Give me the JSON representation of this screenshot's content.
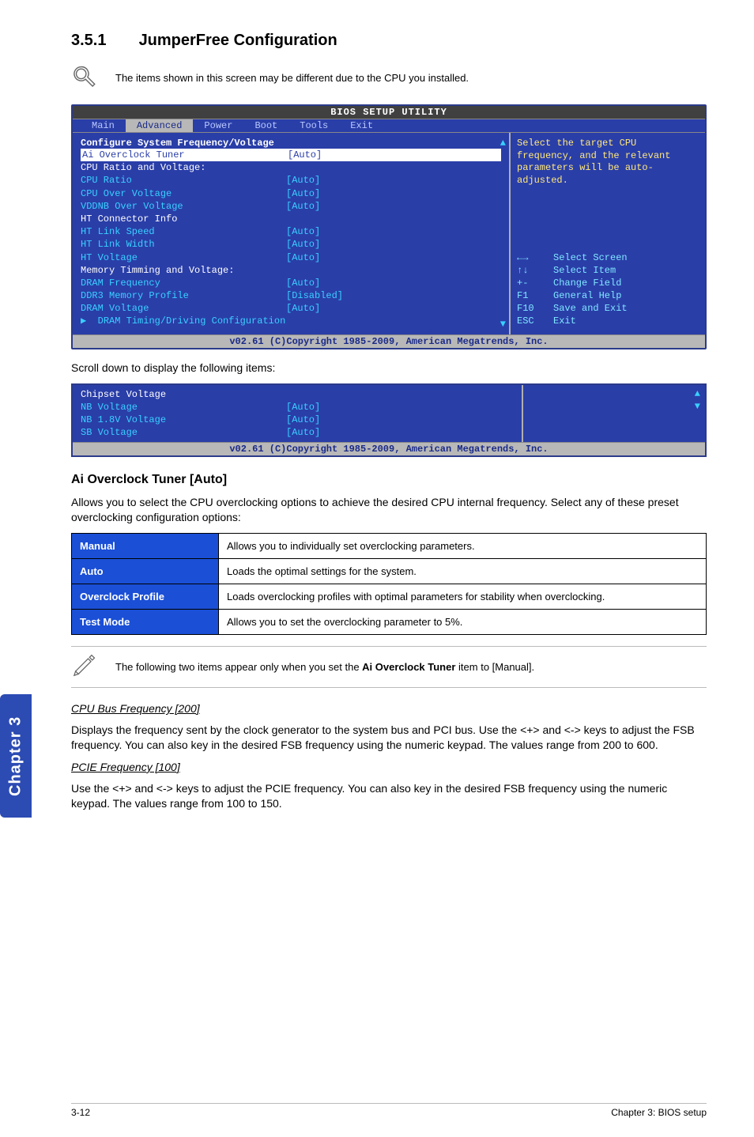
{
  "section": {
    "number": "3.5.1",
    "title": "JumperFree Configuration"
  },
  "note1": "The items shown in this screen may be different due to the CPU you installed.",
  "bios": {
    "title": "BIOS SETUP UTILITY",
    "tabs": [
      "Main",
      "Advanced",
      "Power",
      "Boot",
      "Tools",
      "Exit"
    ],
    "active_tab": 1,
    "main_heading": "Configure System Frequency/Voltage",
    "rows": [
      {
        "label": "Ai Overclock Tuner",
        "value": "[Auto]",
        "highlight": true
      },
      {
        "label": "",
        "value": ""
      },
      {
        "label": "CPU Ratio and Voltage:",
        "value": "",
        "white": true
      },
      {
        "label": "CPU Ratio",
        "value": "[Auto]",
        "bluelabel": true
      },
      {
        "label": "CPU Over Voltage",
        "value": "[Auto]",
        "bluelabel": true
      },
      {
        "label": "VDDNB Over Voltage",
        "value": "[Auto]",
        "bluelabel": true
      },
      {
        "label": "",
        "value": ""
      },
      {
        "label": "HT Connector Info",
        "value": "",
        "white": true
      },
      {
        "label": "HT Link Speed",
        "value": "[Auto]",
        "bluelabel": true
      },
      {
        "label": "HT Link Width",
        "value": "[Auto]",
        "bluelabel": true
      },
      {
        "label": "HT Voltage",
        "value": "[Auto]",
        "bluelabel": true
      },
      {
        "label": "",
        "value": ""
      },
      {
        "label": "Memory Timming and Voltage:",
        "value": "",
        "white": true
      },
      {
        "label": "DRAM Frequency",
        "value": "[Auto]",
        "bluelabel": true
      },
      {
        "label": "DDR3 Memory Profile",
        "value": "[Disabled]",
        "bluelabel": true
      },
      {
        "label": "DRAM Voltage",
        "value": "[Auto]",
        "bluelabel": true
      },
      {
        "label": "▶  DRAM Timing/Driving Configuration",
        "value": "",
        "bluelabel": true
      }
    ],
    "side_top": "Select the target CPU frequency, and the relevant parameters will be auto-adjusted.",
    "help": [
      {
        "key": "←→",
        "text": "Select Screen"
      },
      {
        "key": "↑↓",
        "text": "Select Item"
      },
      {
        "key": "+-",
        "text": "Change Field"
      },
      {
        "key": "F1",
        "text": "General Help"
      },
      {
        "key": "F10",
        "text": "Save and Exit"
      },
      {
        "key": "ESC",
        "text": "Exit"
      }
    ],
    "footer": "v02.61 (C)Copyright 1985-2009, American Megatrends, Inc."
  },
  "scroll_note": "Scroll down to display the following items:",
  "bios2": {
    "rows": [
      {
        "label": "Chipset Voltage",
        "value": "",
        "white": true
      },
      {
        "label": "NB Voltage",
        "value": "[Auto]",
        "bluelabel": true
      },
      {
        "label": "NB 1.8V Voltage",
        "value": "[Auto]",
        "bluelabel": true
      },
      {
        "label": "SB Voltage",
        "value": "[Auto]",
        "bluelabel": true
      }
    ],
    "footer": "v02.61 (C)Copyright 1985-2009, American Megatrends, Inc."
  },
  "ai_heading": "Ai Overclock Tuner [Auto]",
  "ai_desc": "Allows you to select the CPU overclocking options to achieve the desired CPU internal frequency. Select any of these preset overclocking configuration options:",
  "opt_table": [
    {
      "name": "Manual",
      "desc": "Allows you to individually set overclocking parameters."
    },
    {
      "name": "Auto",
      "desc": "Loads the optimal settings for the system."
    },
    {
      "name": "Overclock Profile",
      "desc": "Loads overclocking profiles with optimal parameters for stability when overclocking."
    },
    {
      "name": "Test Mode",
      "desc": "Allows you to set the overclocking parameter to 5%."
    }
  ],
  "note2_prefix": "The following two items appear only when you set the ",
  "note2_bold": "Ai Overclock Tuner",
  "note2_suffix": " item to [Manual].",
  "cpu_bus": {
    "title": "CPU Bus Frequency [200]",
    "body": "Displays the frequency sent by the clock generator to the system bus and PCI bus. Use the <+> and <-> keys to adjust the FSB frequency. You can also key in the desired FSB frequency using the numeric keypad. The values range from 200 to 600."
  },
  "pcie": {
    "title": "PCIE Frequency [100]",
    "body": "Use the <+> and <-> keys to adjust the PCIE frequency. You can also key in the desired FSB frequency using the numeric keypad. The values range from 100 to 150."
  },
  "chapter_tab": "Chapter 3",
  "footer": {
    "left": "3-12",
    "right": "Chapter 3: BIOS setup"
  }
}
